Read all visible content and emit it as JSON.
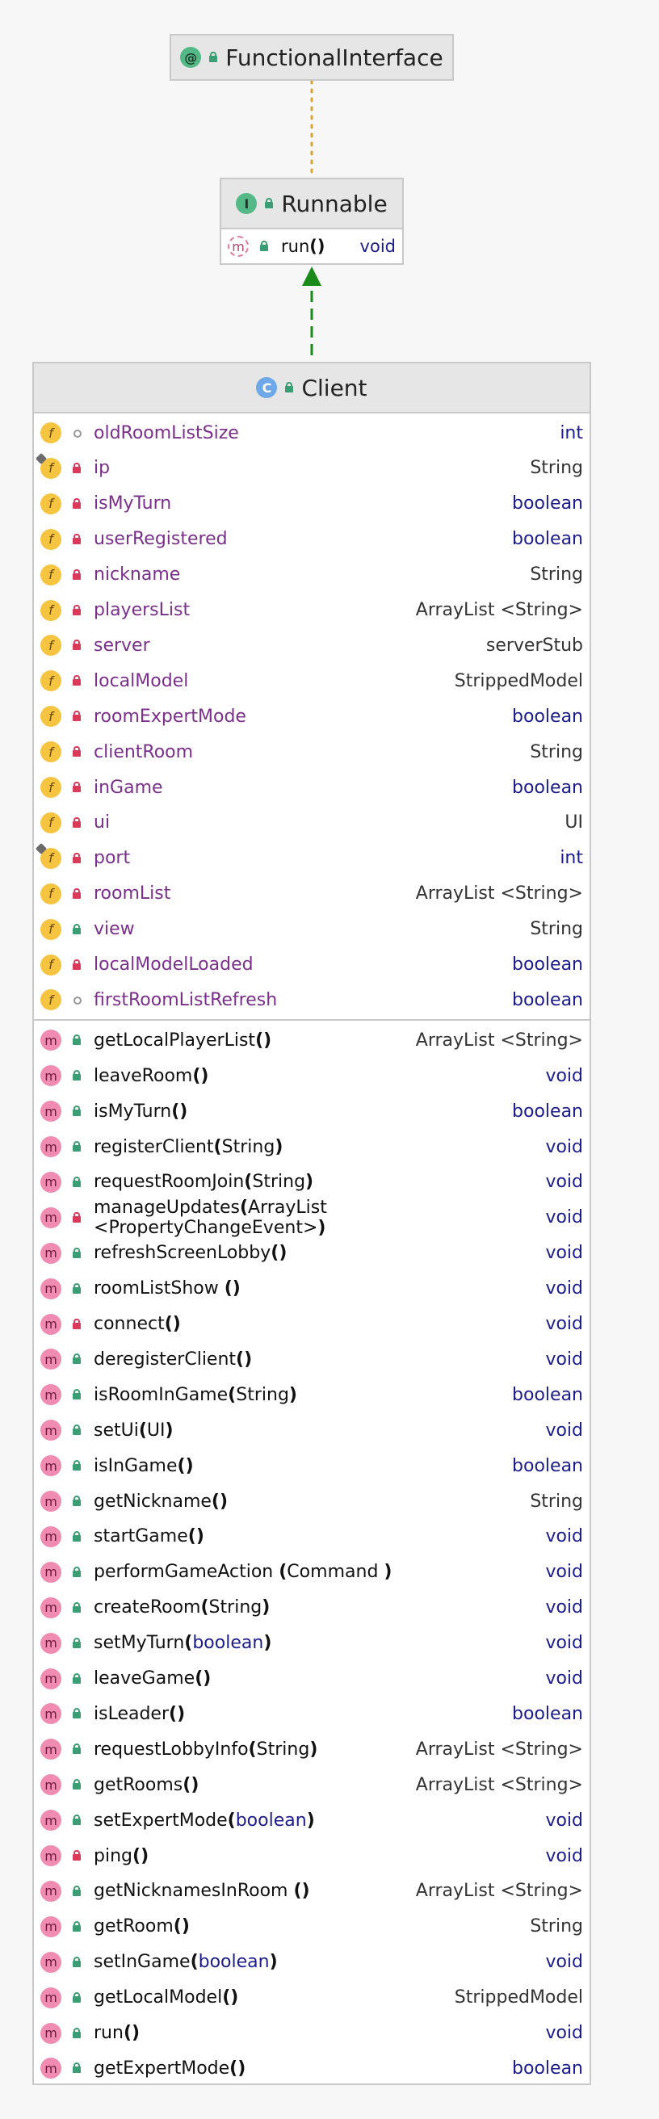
{
  "interfaces": {
    "functional": {
      "name": "FunctionalInterface",
      "badge": "@"
    },
    "runnable": {
      "name": "Runnable",
      "badge": "I",
      "method": {
        "name": "run",
        "parens": "()",
        "type": "void",
        "badge": "m"
      }
    }
  },
  "client": {
    "name": "Client",
    "badge": "C",
    "fields": [
      {
        "name": "oldRoomListSize",
        "type": "int",
        "visibility": "package",
        "kw": true,
        "static_mark": false
      },
      {
        "name": "ip",
        "type": "String",
        "visibility": "private",
        "kw": false,
        "static_mark": true
      },
      {
        "name": "isMyTurn",
        "type": "boolean",
        "visibility": "private",
        "kw": true,
        "static_mark": false
      },
      {
        "name": "userRegistered",
        "type": "boolean",
        "visibility": "private",
        "kw": true,
        "static_mark": false
      },
      {
        "name": "nickname",
        "type": "String",
        "visibility": "private",
        "kw": false,
        "static_mark": false
      },
      {
        "name": "playersList",
        "type": "ArrayList <String>",
        "visibility": "private",
        "kw": false,
        "static_mark": false
      },
      {
        "name": "server",
        "type": "serverStub",
        "visibility": "private",
        "kw": false,
        "static_mark": false
      },
      {
        "name": "localModel",
        "type": "StrippedModel",
        "visibility": "private",
        "kw": false,
        "static_mark": false
      },
      {
        "name": "roomExpertMode",
        "type": "boolean",
        "visibility": "private",
        "kw": true,
        "static_mark": false
      },
      {
        "name": "clientRoom",
        "type": "String",
        "visibility": "private",
        "kw": false,
        "static_mark": false
      },
      {
        "name": "inGame",
        "type": "boolean",
        "visibility": "private",
        "kw": true,
        "static_mark": false
      },
      {
        "name": "ui",
        "type": "UI",
        "visibility": "private",
        "kw": false,
        "static_mark": false
      },
      {
        "name": "port",
        "type": "int",
        "visibility": "private",
        "kw": true,
        "static_mark": true
      },
      {
        "name": "roomList",
        "type": "ArrayList <String>",
        "visibility": "private",
        "kw": false,
        "static_mark": false
      },
      {
        "name": "view",
        "type": "String",
        "visibility": "public",
        "kw": false,
        "static_mark": false
      },
      {
        "name": "localModelLoaded",
        "type": "boolean",
        "visibility": "private",
        "kw": true,
        "static_mark": false
      },
      {
        "name": "firstRoomListRefresh",
        "type": "boolean",
        "visibility": "package",
        "kw": true,
        "static_mark": false
      }
    ],
    "methods": [
      {
        "name": "getLocalPlayerList",
        "params": "()",
        "type": "ArrayList <String>",
        "visibility": "public",
        "kw": false
      },
      {
        "name": "leaveRoom",
        "params": "()",
        "type": "void",
        "visibility": "public",
        "kw": true
      },
      {
        "name": "isMyTurn",
        "params": "()",
        "type": "boolean",
        "visibility": "public",
        "kw": true
      },
      {
        "name": "registerClient",
        "params": "(String)",
        "type": "void",
        "visibility": "public",
        "kw": true
      },
      {
        "name": "requestRoomJoin",
        "params": "(String)",
        "type": "void",
        "visibility": "public",
        "kw": true
      },
      {
        "name": "manageUpdates",
        "params": "(ArrayList <PropertyChangeEvent>)",
        "type": "void",
        "visibility": "private",
        "kw": true
      },
      {
        "name": "refreshScreenLobby",
        "params": "()",
        "type": "void",
        "visibility": "public",
        "kw": true
      },
      {
        "name": "roomListShow",
        "params": " ()",
        "type": "void",
        "visibility": "public",
        "kw": true
      },
      {
        "name": "connect",
        "params": "()",
        "type": "void",
        "visibility": "private",
        "kw": true
      },
      {
        "name": "deregisterClient",
        "params": "()",
        "type": "void",
        "visibility": "public",
        "kw": true
      },
      {
        "name": "isRoomInGame",
        "params": "(String)",
        "type": "boolean",
        "visibility": "public",
        "kw": true
      },
      {
        "name": "setUi",
        "params": "(UI)",
        "type": "void",
        "visibility": "public",
        "kw": true
      },
      {
        "name": "isInGame",
        "params": "()",
        "type": "boolean",
        "visibility": "public",
        "kw": true
      },
      {
        "name": "getNickname",
        "params": "()",
        "type": "String",
        "visibility": "public",
        "kw": false
      },
      {
        "name": "startGame",
        "params": "()",
        "type": "void",
        "visibility": "public",
        "kw": true
      },
      {
        "name": "performGameAction",
        "params": " (Command )",
        "type": "void",
        "visibility": "public",
        "kw": true
      },
      {
        "name": "createRoom",
        "params": "(String)",
        "type": "void",
        "visibility": "public",
        "kw": true
      },
      {
        "name": "setMyTurn",
        "params": "(boolean)",
        "type": "void",
        "visibility": "public",
        "kw": true,
        "param_kw": true
      },
      {
        "name": "leaveGame",
        "params": "()",
        "type": "void",
        "visibility": "public",
        "kw": true
      },
      {
        "name": "isLeader",
        "params": "()",
        "type": "boolean",
        "visibility": "public",
        "kw": true
      },
      {
        "name": "requestLobbyInfo",
        "params": "(String)",
        "type": "ArrayList <String>",
        "visibility": "public",
        "kw": false
      },
      {
        "name": "getRooms",
        "params": "()",
        "type": "ArrayList <String>",
        "visibility": "public",
        "kw": false
      },
      {
        "name": "setExpertMode",
        "params": "(boolean)",
        "type": "void",
        "visibility": "public",
        "kw": true,
        "param_kw": true
      },
      {
        "name": "ping",
        "params": "()",
        "type": "void",
        "visibility": "private",
        "kw": true
      },
      {
        "name": "getNicknamesInRoom",
        "params": " ()",
        "type": "ArrayList <String>",
        "visibility": "public",
        "kw": false
      },
      {
        "name": "getRoom",
        "params": "()",
        "type": "String",
        "visibility": "public",
        "kw": false
      },
      {
        "name": "setInGame",
        "params": "(boolean)",
        "type": "void",
        "visibility": "public",
        "kw": true,
        "param_kw": true
      },
      {
        "name": "getLocalModel",
        "params": "()",
        "type": "StrippedModel",
        "visibility": "public",
        "kw": false
      },
      {
        "name": "run",
        "params": "()",
        "type": "void",
        "visibility": "public",
        "kw": true
      },
      {
        "name": "getExpertMode",
        "params": "()",
        "type": "boolean",
        "visibility": "public",
        "kw": true
      }
    ]
  },
  "colors": {
    "dotted_link": "#d6a531",
    "implements_link": "#1a8a1a"
  }
}
